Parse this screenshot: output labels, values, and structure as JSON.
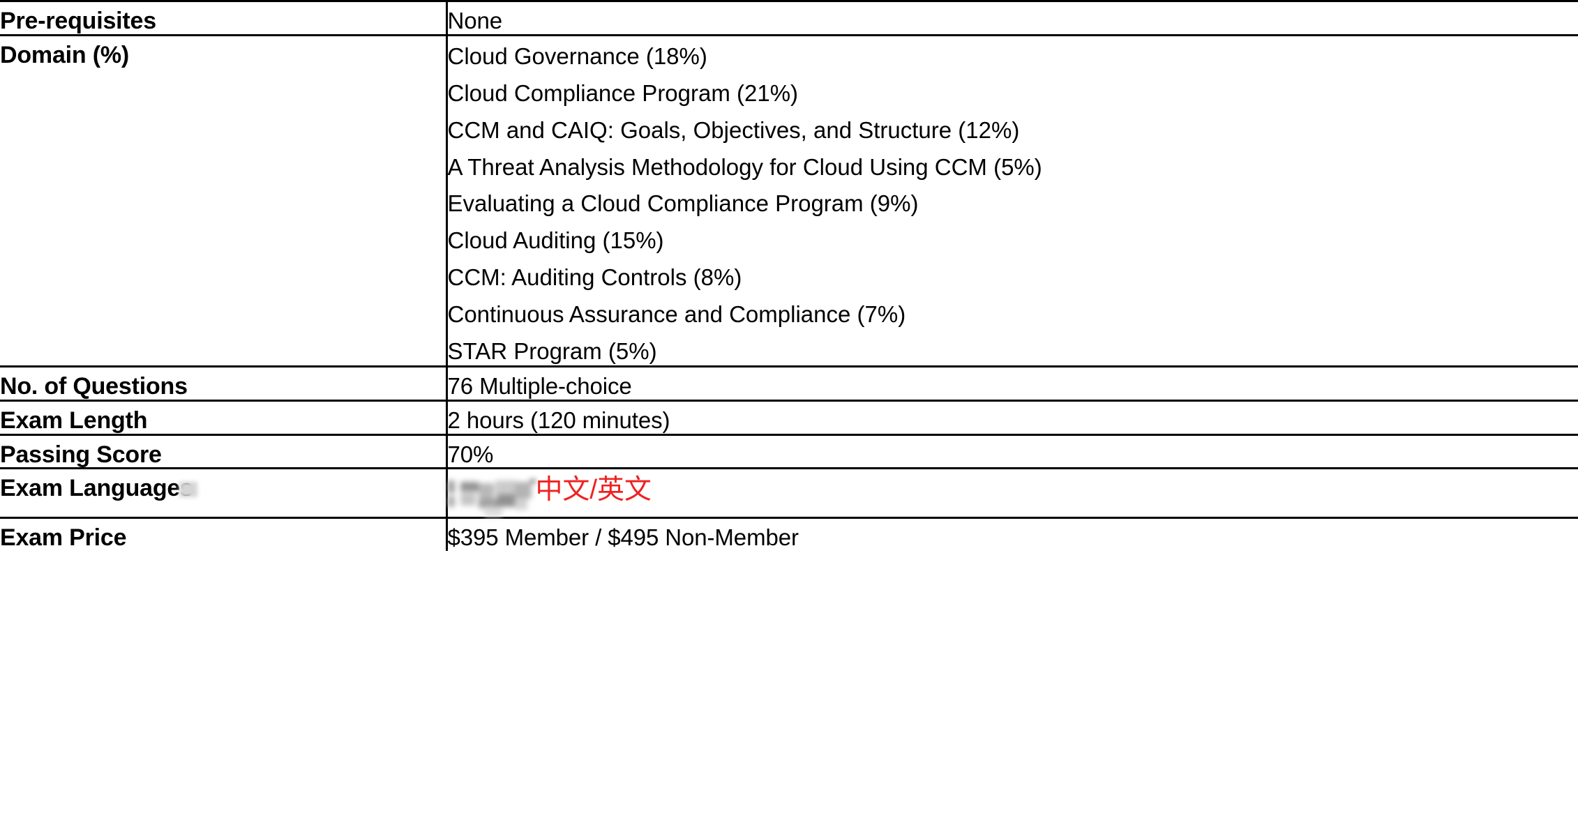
{
  "table": {
    "rows": [
      {
        "id": "pre-requisites",
        "label": "Pre-requisites",
        "value": "None"
      },
      {
        "id": "domain",
        "label": "Domain (%)",
        "domains": [
          "Cloud Governance (18%)",
          "Cloud Compliance Program (21%)",
          "CCM and CAIQ: Goals, Objectives, and Structure (12%)",
          "A Threat Analysis Methodology for Cloud Using CCM (5%)",
          "Evaluating a Cloud Compliance Program (9%)",
          "Cloud Auditing (15%)",
          "CCM: Auditing Controls (8%)",
          "Continuous Assurance and Compliance (7%)",
          "STAR Program (5%)"
        ]
      },
      {
        "id": "no-of-questions",
        "label": "No. of Questions",
        "value": "76 Multiple-choice"
      },
      {
        "id": "exam-length",
        "label": "Exam Length",
        "value": "2 hours (120 minutes)"
      },
      {
        "id": "passing-score",
        "label": "Passing Score",
        "value": "70%"
      },
      {
        "id": "exam-languages",
        "label": "Exam Languages",
        "value_cjk": "中文/英文",
        "redacted": true
      },
      {
        "id": "exam-price",
        "label": "Exam Price",
        "value": "$395 Member / $495 Non-Member"
      }
    ]
  },
  "colors": {
    "border": "#000000",
    "text": "#000000",
    "annotation_red": "#ee2222",
    "redaction_grey": "#b5b5b5",
    "background": "#ffffff"
  }
}
